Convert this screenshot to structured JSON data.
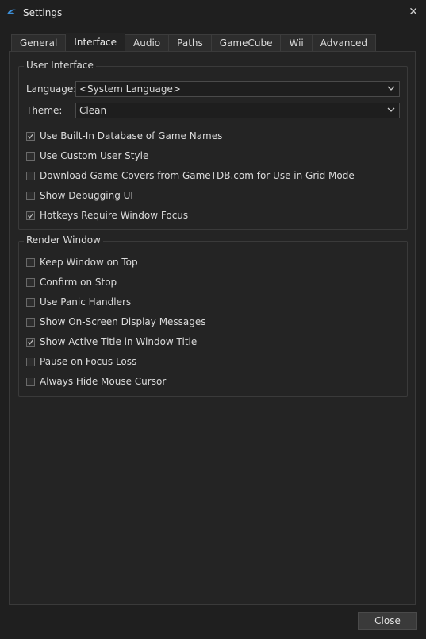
{
  "window": {
    "title": "Settings",
    "close_symbol": "✕"
  },
  "tabs": [
    {
      "label": "General",
      "active": false
    },
    {
      "label": "Interface",
      "active": true
    },
    {
      "label": "Audio",
      "active": false
    },
    {
      "label": "Paths",
      "active": false
    },
    {
      "label": "GameCube",
      "active": false
    },
    {
      "label": "Wii",
      "active": false
    },
    {
      "label": "Advanced",
      "active": false
    }
  ],
  "user_interface": {
    "title": "User Interface",
    "language_label": "Language:",
    "language_value": "<System Language>",
    "theme_label": "Theme:",
    "theme_value": "Clean",
    "checks": [
      {
        "label": "Use Built-In Database of Game Names",
        "checked": true
      },
      {
        "label": "Use Custom User Style",
        "checked": false
      },
      {
        "label": "Download Game Covers from GameTDB.com for Use in Grid Mode",
        "checked": false
      },
      {
        "label": "Show Debugging UI",
        "checked": false
      },
      {
        "label": "Hotkeys Require Window Focus",
        "checked": true
      }
    ]
  },
  "render_window": {
    "title": "Render Window",
    "checks": [
      {
        "label": "Keep Window on Top",
        "checked": false
      },
      {
        "label": "Confirm on Stop",
        "checked": false
      },
      {
        "label": "Use Panic Handlers",
        "checked": false
      },
      {
        "label": "Show On-Screen Display Messages",
        "checked": false
      },
      {
        "label": "Show Active Title in Window Title",
        "checked": true
      },
      {
        "label": "Pause on Focus Loss",
        "checked": false
      },
      {
        "label": "Always Hide Mouse Cursor",
        "checked": false
      }
    ]
  },
  "buttons": {
    "close_label": "Close"
  },
  "colors": {
    "background": "#1f1f1f",
    "accent": "#3d8fd8",
    "text": "#dcdcdc"
  }
}
